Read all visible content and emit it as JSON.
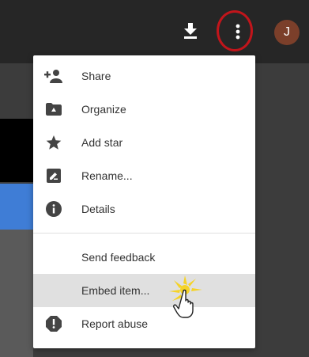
{
  "toolbar": {
    "download_icon": "download-icon",
    "more_icon": "more-vert-icon",
    "avatar_initial": "J"
  },
  "menu": {
    "items": [
      {
        "label": "Share",
        "icon": "person-add-icon"
      },
      {
        "label": "Organize",
        "icon": "folder-drive-icon"
      },
      {
        "label": "Add star",
        "icon": "star-icon"
      },
      {
        "label": "Rename...",
        "icon": "rename-icon"
      },
      {
        "label": "Details",
        "icon": "info-icon"
      },
      {
        "label": "Send feedback",
        "icon": ""
      },
      {
        "label": "Embed item...",
        "icon": ""
      },
      {
        "label": "Report abuse",
        "icon": "report-icon"
      }
    ]
  },
  "colors": {
    "topbar": "#262626",
    "menu_bg": "#ffffff",
    "hover_bg": "#e0e0e0",
    "highlight_ring": "#c1151b",
    "avatar_bg": "#7b3f2a"
  }
}
